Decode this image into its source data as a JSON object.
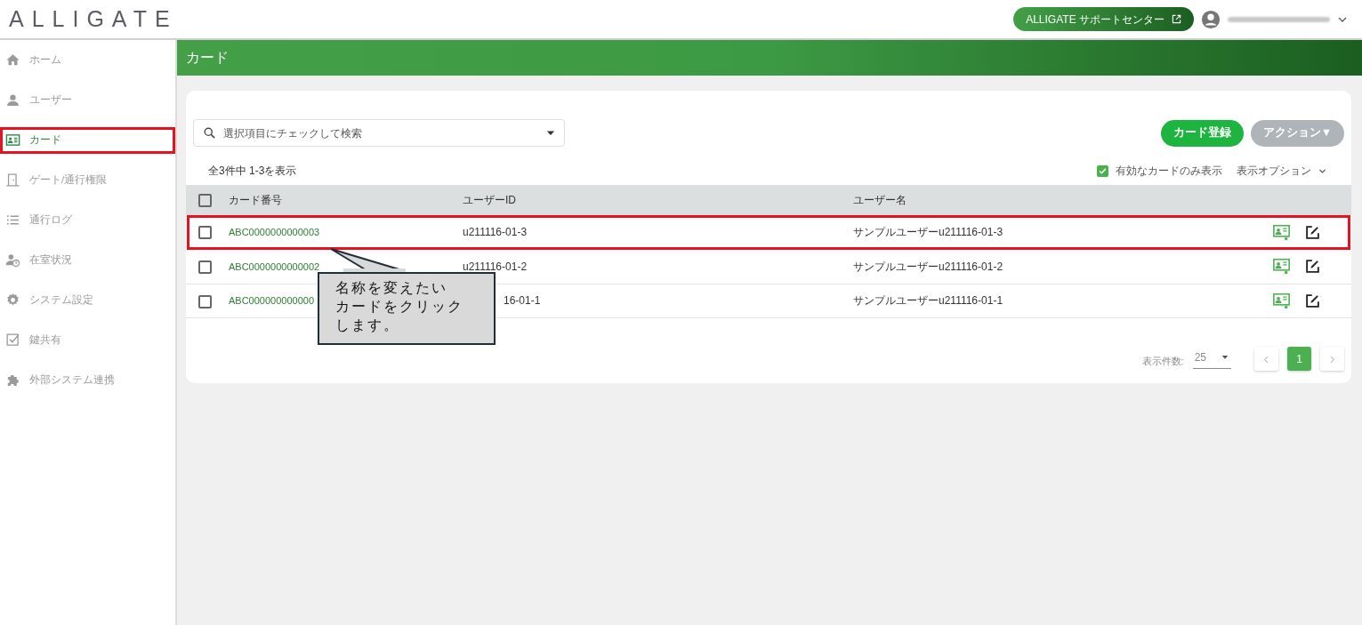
{
  "header": {
    "logo": "ALLIGATE",
    "support_button": "ALLIGATE サポートセンター"
  },
  "sidebar": {
    "items": [
      {
        "label": "ホーム",
        "selected": false,
        "highlighted": false
      },
      {
        "label": "ユーザー",
        "selected": false,
        "highlighted": false
      },
      {
        "label": "カード",
        "selected": true,
        "highlighted": true
      },
      {
        "label": "ゲート/通行権限",
        "selected": false,
        "highlighted": false
      },
      {
        "label": "通行ログ",
        "selected": false,
        "highlighted": false
      },
      {
        "label": "在室状況",
        "selected": false,
        "highlighted": false
      },
      {
        "label": "システム設定",
        "selected": false,
        "highlighted": false
      },
      {
        "label": "鍵共有",
        "selected": false,
        "highlighted": false
      },
      {
        "label": "外部システム連携",
        "selected": false,
        "highlighted": false
      }
    ]
  },
  "page_title": "カード",
  "search": {
    "placeholder": "選択項目にチェックして検索"
  },
  "buttons": [
    {
      "label": "カード登録",
      "disabled": false
    },
    {
      "label": "アクション▼",
      "disabled": true
    }
  ],
  "result_count": "全3件中 1-3を表示",
  "active_only": {
    "label": "有効なカードのみ表示",
    "checked": true
  },
  "display_options": "表示オプション",
  "table": {
    "select_all_checked": false,
    "columns": [
      "カード番号",
      "ユーザーID",
      "ユーザー名"
    ],
    "rows": [
      {
        "checked": false,
        "highlighted": true,
        "card_number": "ABC0000000000003",
        "user_id": "u211116-01-3",
        "user_name": "サンプルユーザーu211116-01-3"
      },
      {
        "checked": false,
        "highlighted": false,
        "card_number": "ABC0000000000002",
        "user_id": "u211116-01-2",
        "user_name": "サンプルユーザーu211116-01-2"
      },
      {
        "checked": false,
        "highlighted": false,
        "card_number": "ABC000000000000",
        "user_id": "16-01-1",
        "user_name": "サンプルユーザーu211116-01-1"
      }
    ]
  },
  "pagination": {
    "page_size_label": "表示件数:",
    "page_size": "25",
    "pages": [
      {
        "label": "1",
        "selected": true
      }
    ]
  },
  "callout": {
    "lines": [
      "名称を変えたい",
      "カードをクリック",
      "します。"
    ]
  }
}
